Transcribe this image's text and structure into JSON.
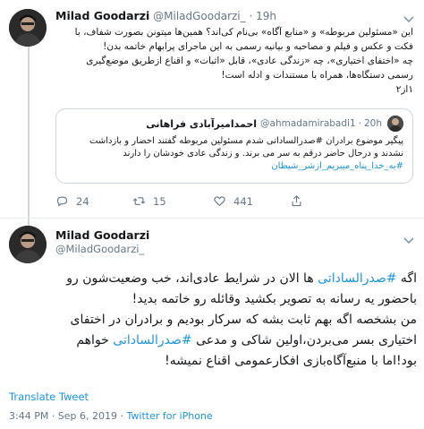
{
  "parent_tweet": {
    "author_name": "Milad Goodarzi",
    "handle": "@MiladGoodarzi_",
    "separator": "·",
    "time": "19h",
    "text_lines": [
      "این «مسئولین مربوطه» و «منابع آگاه» بی‌نام کی‌اند؟ همین‌ها میتونن بصورت شفاف، با",
      "فکت و عکس و فیلم و مصاحبه و بیانیه رسمی به این ماجرای پرابهام خاتمه بدن!",
      "چه «اختفای اختیاری»، چه «زندگی عادی»، قابل «اثبات» و اقناع ازطریق موضع‌گیری",
      "رسمی دستگاه‌ها، همراه با مستندات و ادله است!",
      "۱از۲"
    ],
    "quote": {
      "author_name": "احمدامیرآبادی فراهانی",
      "handle": "@ahmadamirabadi1",
      "separator": "·",
      "time": "20h",
      "line1": "پیگیر موضوع برادران #صدرالساداتی شدم مسئولین مربوطه گفتند احضار و بازداشت",
      "line2": "نشدند و درحال حاضر درقم به سر می برند. و زندگی عادی خودشان را دارند",
      "line3": "#به_خدا_پناه_میبریم_ازشر_شیطان"
    },
    "actions": {
      "reply_count": "24",
      "retweet_count": "15",
      "like_count": "441",
      "share_count": ""
    }
  },
  "main_tweet": {
    "author_name": "Milad Goodarzi",
    "handle": "@MiladGoodarzi_",
    "text": {
      "l1_a": "اگه ",
      "l1_tag": "#صدرالساداتی",
      "l1_b": " ها الان در شرایط عادی‌اند، خب وضعیت‌شون رو",
      "l2": "باحضور یه رسانه به تصویر بکشید وقائله رو خاتمه بدید!",
      "l3": "من بشخصه اگه بهم ثابت بشه که سرکار بودیم و برادران در اختفای",
      "l4_a": "اختیاری بسر می‌بردن،اولین شاکی و مدعی ",
      "l4_tag": "#صدرالساداتی",
      "l4_b": " خواهم",
      "l5": "بود!اما با منبع‌آگاه‌بازی افکارعمومی اقناع نمیشه!"
    },
    "translate_label": "Translate Tweet",
    "timestamp": "3:44 PM · Sep 6, 2019 · ",
    "source": "Twitter for iPhone"
  },
  "colors": {
    "link": "#1b95e0",
    "secondary_text": "#657786",
    "border": "#ccd6dd"
  }
}
